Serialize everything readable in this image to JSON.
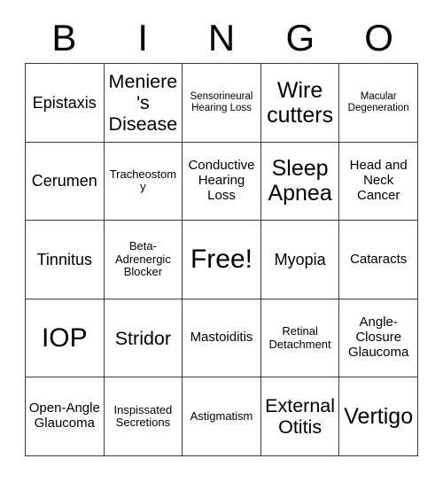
{
  "card": {
    "title": "BINGO",
    "header_letters": [
      "B",
      "I",
      "N",
      "G",
      "O"
    ],
    "free_space_label": "Free!",
    "grid_columns": 5,
    "grid_rows": 5,
    "colors": {
      "background": "#ffffff",
      "text": "#000000",
      "grid_line": "#3a3a3a"
    },
    "cells": [
      {
        "label": "Epistaxis",
        "size": "lg"
      },
      {
        "label": "Meniere's Disease",
        "size": "xl"
      },
      {
        "label": "Sensorineural Hearing Loss",
        "size": "xs"
      },
      {
        "label": "Wire cutters",
        "size": "xxl"
      },
      {
        "label": "Macular Degeneration",
        "size": "xs"
      },
      {
        "label": "Cerumen",
        "size": "lg"
      },
      {
        "label": "Tracheostomy",
        "size": "sm"
      },
      {
        "label": "Conductive Hearing Loss",
        "size": "md"
      },
      {
        "label": "Sleep Apnea",
        "size": "xxl"
      },
      {
        "label": "Head and Neck Cancer",
        "size": "md"
      },
      {
        "label": "Tinnitus",
        "size": "lg"
      },
      {
        "label": "Beta-Adrenergic Blocker",
        "size": "sm"
      },
      {
        "label": "Free!",
        "size": "huge"
      },
      {
        "label": "Myopia",
        "size": "lg"
      },
      {
        "label": "Cataracts",
        "size": "md"
      },
      {
        "label": "IOP",
        "size": "huge"
      },
      {
        "label": "Stridor",
        "size": "xl"
      },
      {
        "label": "Mastoiditis",
        "size": "md"
      },
      {
        "label": "Retinal Detachment",
        "size": "sm"
      },
      {
        "label": "Angle-Closure Glaucoma",
        "size": "md"
      },
      {
        "label": "Open-Angle Glaucoma",
        "size": "md"
      },
      {
        "label": "Inspissated Secretions",
        "size": "sm"
      },
      {
        "label": "Astigmatism",
        "size": "sm"
      },
      {
        "label": "External Otitis",
        "size": "xl"
      },
      {
        "label": "Vertigo",
        "size": "xxl"
      }
    ]
  }
}
